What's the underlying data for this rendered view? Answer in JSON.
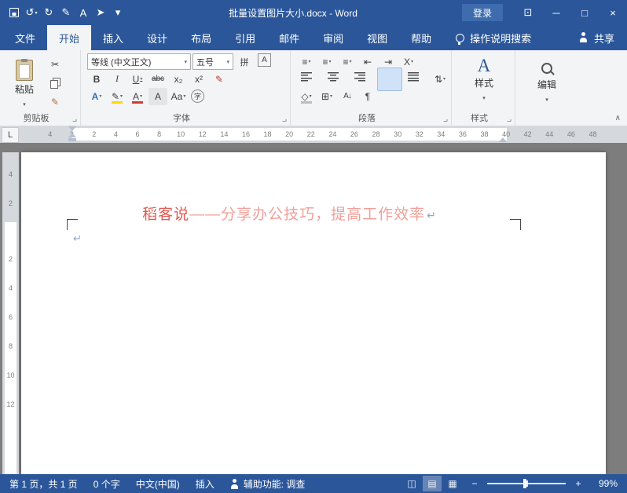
{
  "titlebar": {
    "title": "批量设置图片大小.docx - Word",
    "signin_label": "登录",
    "qat": [
      {
        "name": "save-button",
        "cls": "i-floppy",
        "glyph": ""
      },
      {
        "name": "undo-button",
        "glyph": "↺",
        "drop": true
      },
      {
        "name": "redo-button",
        "glyph": "↻"
      },
      {
        "name": "draw-tool-button",
        "glyph": "✎"
      },
      {
        "name": "font-tool-button",
        "glyph": "A"
      },
      {
        "name": "select-tool-button",
        "glyph": "➤"
      },
      {
        "name": "customize-qat-button",
        "glyph": "▾"
      }
    ],
    "window_icons": [
      {
        "name": "ribbon-display-options-button",
        "glyph": "⊡"
      },
      {
        "name": "minimize-button",
        "glyph": "─"
      },
      {
        "name": "maximize-button",
        "glyph": "□"
      },
      {
        "name": "close-button",
        "glyph": "×"
      }
    ]
  },
  "tabs": [
    {
      "name": "tab-file",
      "label": "文件"
    },
    {
      "name": "tab-home",
      "label": "开始",
      "active": true
    },
    {
      "name": "tab-insert",
      "label": "插入"
    },
    {
      "name": "tab-design",
      "label": "设计"
    },
    {
      "name": "tab-layout",
      "label": "布局"
    },
    {
      "name": "tab-references",
      "label": "引用"
    },
    {
      "name": "tab-mailings",
      "label": "邮件"
    },
    {
      "name": "tab-review",
      "label": "审阅"
    },
    {
      "name": "tab-view",
      "label": "视图"
    },
    {
      "name": "tab-help",
      "label": "帮助"
    }
  ],
  "tellme_label": "操作说明搜索",
  "share_label": "共享",
  "ribbon": {
    "collapse_glyph": "∧",
    "clipboard": {
      "label": "剪贴板",
      "paste_label": "粘贴",
      "tools": [
        {
          "name": "cut-icon",
          "glyph": "✂"
        },
        {
          "name": "copy-icon",
          "cls": "i-copy",
          "glyph": ""
        },
        {
          "name": "format-painter-icon",
          "glyph": "✎",
          "cls": "painter"
        }
      ]
    },
    "font": {
      "label": "字体",
      "name_value": "等线 (中文正文)",
      "size_value": "五号",
      "row1_icons": [
        {
          "name": "phonetic-guide-button",
          "glyph": "拼",
          "cls": "cjk"
        },
        {
          "name": "char-border-button",
          "glyph": "A",
          "cls": "boxed"
        }
      ],
      "row2_icons": [
        {
          "name": "bold-button",
          "glyph": "B",
          "cls": "b"
        },
        {
          "name": "italic-button",
          "glyph": "I",
          "cls": "it"
        },
        {
          "name": "underline-button",
          "glyph": "U",
          "cls": "u",
          "drop": true
        },
        {
          "name": "strikethrough-button",
          "glyph": "abc",
          "cls": "strike"
        },
        {
          "name": "subscript-button",
          "glyph": "x₂"
        },
        {
          "name": "superscript-button",
          "glyph": "x²"
        },
        {
          "name": "ink-icon",
          "glyph": "✎",
          "cls": "red-ink"
        }
      ],
      "row3_icons": [
        {
          "name": "text-effects-button",
          "glyph": "A",
          "cls": "fx",
          "drop": true
        },
        {
          "name": "highlight-color-button",
          "glyph": "✎",
          "cls": "ubar-yellow",
          "drop": true
        },
        {
          "name": "font-color-button",
          "glyph": "A",
          "cls": "ubar-red",
          "drop": true
        },
        {
          "name": "char-shading-button",
          "glyph": "A",
          "cls": "shade"
        },
        {
          "name": "change-case-button",
          "glyph": "Aa",
          "drop": true
        },
        {
          "name": "enclose-characters-button",
          "glyph": "字",
          "cls": "circled"
        }
      ]
    },
    "paragraph": {
      "label": "段落",
      "row1_icons": [
        {
          "name": "bullets-button",
          "glyph": "≡",
          "drop": true
        },
        {
          "name": "numbering-button",
          "glyph": "≡",
          "drop": true
        },
        {
          "name": "multilevel-list-button",
          "glyph": "≡",
          "drop": true
        },
        {
          "name": "decrease-indent-button",
          "glyph": "⇤"
        },
        {
          "name": "increase-indent-button",
          "glyph": "⇥"
        },
        {
          "name": "asian-layout-button",
          "glyph": "X",
          "drop": true
        }
      ],
      "row2_icons": [
        {
          "name": "align-left-button",
          "cls": "al al-left",
          "glyph": ""
        },
        {
          "name": "align-center-button",
          "cls": "al al-center",
          "glyph": ""
        },
        {
          "name": "align-right-button",
          "cls": "al al-right",
          "glyph": ""
        },
        {
          "name": "justify-button",
          "cls": "al al-justify",
          "glyph": "",
          "active": true
        },
        {
          "name": "distribute-button",
          "cls": "al al-dist",
          "glyph": ""
        },
        {
          "name": "line-spacing-button",
          "glyph": "⇅",
          "drop": true
        }
      ],
      "row3_icons": [
        {
          "name": "shading-button",
          "glyph": "◇",
          "cls": "ubar-gray",
          "drop": true
        },
        {
          "name": "borders-button",
          "glyph": "⊞",
          "drop": true
        },
        {
          "name": "sort-button",
          "glyph": "A↓",
          "cls": "small-gl"
        },
        {
          "name": "show-hide-button",
          "glyph": "¶"
        }
      ]
    },
    "styles": {
      "label": "样式",
      "button_label": "样式",
      "icon_glyph": "A"
    },
    "editing": {
      "button_label": "编辑"
    }
  },
  "ruler": {
    "tab_stop_glyph": "L",
    "h_margin": [
      "4",
      "2"
    ],
    "h_main": [
      "2",
      "4",
      "6",
      "8",
      "10",
      "12",
      "14",
      "16",
      "18",
      "20",
      "22",
      "24",
      "26",
      "28",
      "30",
      "32",
      "34",
      "36",
      "38",
      "40",
      "42",
      "44",
      "46",
      "48"
    ],
    "v_margin": [
      "4",
      "2"
    ],
    "v_main": [
      "2",
      "4",
      "6",
      "8",
      "10",
      "12"
    ]
  },
  "document": {
    "heading_accent": "稻客说",
    "heading_rest": "——分享办公技巧，提高工作效率",
    "para_mark": "↵"
  },
  "statusbar": {
    "page_info": "第 1 页，共 1 页",
    "word_count": "0 个字",
    "language": "中文(中国)",
    "insert_mode": "插入",
    "accessibility": "辅助功能: 调查",
    "zoom_out_glyph": "−",
    "zoom_in_glyph": "+",
    "zoom_percent": "99%",
    "view_icons": [
      {
        "name": "read-mode-button",
        "glyph": "◫"
      },
      {
        "name": "print-layout-button",
        "glyph": "▤",
        "active": true
      },
      {
        "name": "web-layout-button",
        "glyph": "▦"
      }
    ]
  },
  "colors": {
    "title_blue": "#2b579a",
    "ribbon_bg": "#f3f4f6",
    "doc_bg": "#7d7d7d",
    "accent_text": "#e25a52",
    "accent_text_light": "#ef9f99"
  }
}
